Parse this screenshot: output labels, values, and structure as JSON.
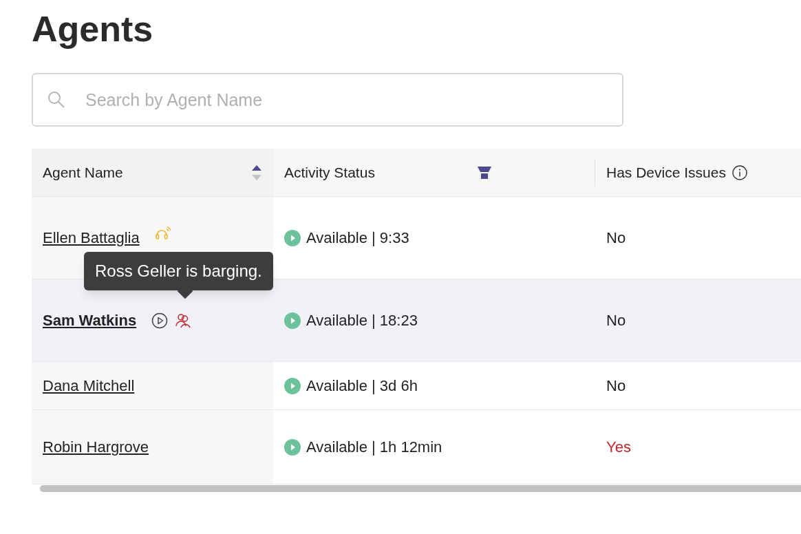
{
  "title": "Agents",
  "search": {
    "placeholder": "Search by Agent Name"
  },
  "columns": [
    {
      "label": "Agent Name",
      "kind": "sort",
      "ascending": true
    },
    {
      "label": "Activity Status",
      "kind": "filter",
      "filtered": true
    },
    {
      "label": "Has Device Issues",
      "kind": "info"
    }
  ],
  "rows": [
    {
      "name": "Ellen Battaglia",
      "selected": false,
      "icons": [
        {
          "kind": "headset"
        }
      ],
      "status": "Available | 9:33",
      "device_issue": "No",
      "alert": false
    },
    {
      "name": "Sam Watkins",
      "selected": true,
      "icons": [
        {
          "kind": "play"
        },
        {
          "kind": "barge"
        }
      ],
      "status": "Available | 18:23",
      "device_issue": "No",
      "alert": false,
      "tooltip": "Ross Geller is barging."
    },
    {
      "name": "Dana Mitchell",
      "selected": false,
      "icons": [],
      "status": "Available | 3d 6h",
      "device_issue": "No",
      "alert": false
    },
    {
      "name": "Robin Hargrove",
      "selected": false,
      "icons": [],
      "status": "Available | 1h 12min",
      "device_issue": "Yes",
      "alert": true
    }
  ]
}
